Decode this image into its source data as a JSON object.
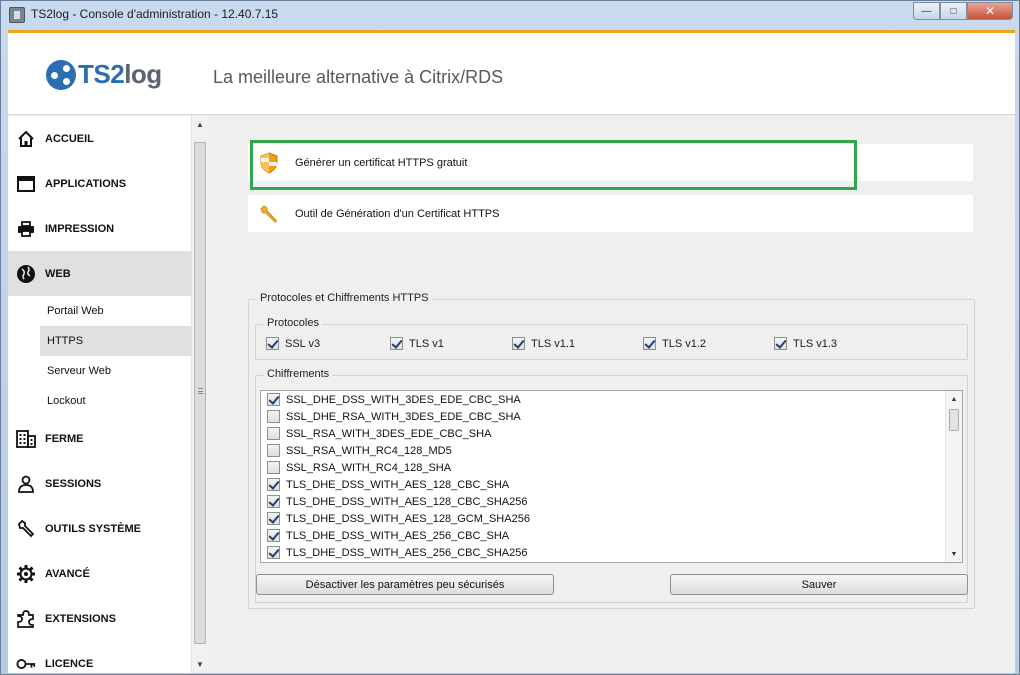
{
  "window": {
    "title": "TS2log - Console d'administration - 12.40.7.15",
    "controls": {
      "minimize": "—",
      "maximize": "□",
      "close": "✕"
    }
  },
  "header": {
    "logo_part1": "TS2",
    "logo_part2": "log",
    "tagline": "La meilleure alternative à Citrix/RDS"
  },
  "sidebar": {
    "items": [
      {
        "label": "ACCUEIL",
        "icon": "home-icon"
      },
      {
        "label": "APPLICATIONS",
        "icon": "window-icon"
      },
      {
        "label": "IMPRESSION",
        "icon": "printer-icon"
      },
      {
        "label": "WEB",
        "icon": "globe-icon",
        "active": true
      }
    ],
    "subitems": [
      {
        "label": "Portail Web"
      },
      {
        "label": "HTTPS",
        "active": true
      },
      {
        "label": "Serveur Web"
      },
      {
        "label": "Lockout"
      }
    ],
    "items_after": [
      {
        "label": "FERME",
        "icon": "building-icon"
      },
      {
        "label": "SESSIONS",
        "icon": "user-icon"
      },
      {
        "label": "OUTILS SYSTÈME",
        "icon": "wrench-icon"
      },
      {
        "label": "AVANCÉ",
        "icon": "gear-icon"
      },
      {
        "label": "EXTENSIONS",
        "icon": "puzzle-icon"
      },
      {
        "label": "LICENCE",
        "icon": "key-icon"
      }
    ]
  },
  "actions": {
    "generate_free_cert": "Générer un certificat HTTPS gratuit",
    "cert_tool": "Outil de Génération d'un Certificat HTTPS"
  },
  "https_settings": {
    "group_title": "Protocoles et Chiffrements HTTPS",
    "protocols_title": "Protocoles",
    "protocols": [
      {
        "label": "SSL v3",
        "checked": true
      },
      {
        "label": "TLS v1",
        "checked": true
      },
      {
        "label": "TLS v1.1",
        "checked": true
      },
      {
        "label": "TLS v1.2",
        "checked": true
      },
      {
        "label": "TLS v1.3",
        "checked": true
      }
    ],
    "ciphers_title": "Chiffrements",
    "ciphers": [
      {
        "label": "SSL_DHE_DSS_WITH_3DES_EDE_CBC_SHA",
        "checked": true
      },
      {
        "label": "SSL_DHE_RSA_WITH_3DES_EDE_CBC_SHA",
        "checked": false
      },
      {
        "label": "SSL_RSA_WITH_3DES_EDE_CBC_SHA",
        "checked": false
      },
      {
        "label": "SSL_RSA_WITH_RC4_128_MD5",
        "checked": false
      },
      {
        "label": "SSL_RSA_WITH_RC4_128_SHA",
        "checked": false
      },
      {
        "label": "TLS_DHE_DSS_WITH_AES_128_CBC_SHA",
        "checked": true
      },
      {
        "label": "TLS_DHE_DSS_WITH_AES_128_CBC_SHA256",
        "checked": true
      },
      {
        "label": "TLS_DHE_DSS_WITH_AES_128_GCM_SHA256",
        "checked": true
      },
      {
        "label": "TLS_DHE_DSS_WITH_AES_256_CBC_SHA",
        "checked": true
      },
      {
        "label": "TLS_DHE_DSS_WITH_AES_256_CBC_SHA256",
        "checked": true
      }
    ],
    "disable_insecure_button": "Désactiver les paramètres peu sécurisés",
    "save_button": "Sauver"
  },
  "colors": {
    "accent": "#f0a21f",
    "highlight": "#2ea84a",
    "brand": "#2b6fb0"
  }
}
